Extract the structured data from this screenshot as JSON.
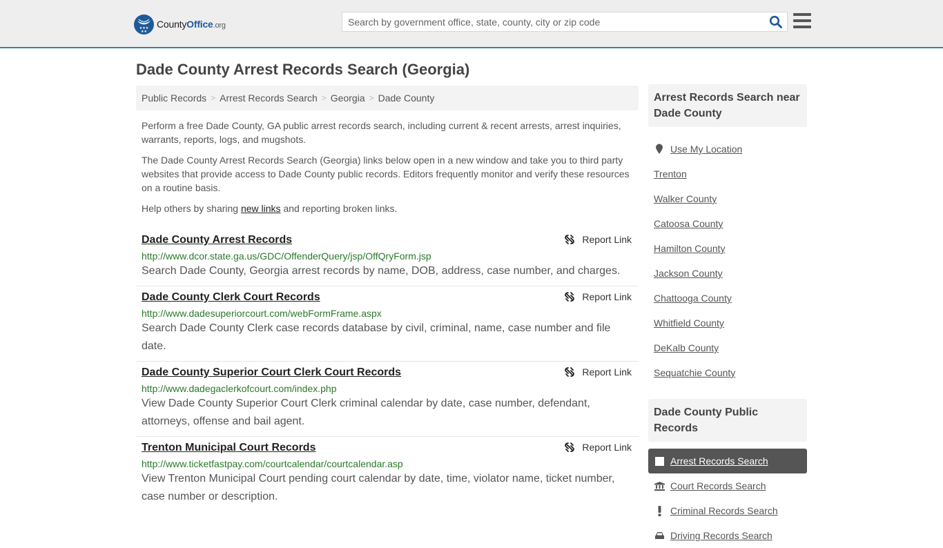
{
  "header": {
    "logo": {
      "name_part1": "County",
      "name_part2": "Office",
      "name_suffix": ".org"
    },
    "search": {
      "placeholder": "Search by government office, state, county, city or zip code",
      "value": ""
    },
    "colors": {
      "brand": "#1e5a99",
      "border_accent": "#3a7cac"
    }
  },
  "page": {
    "title": "Dade County Arrest Records Search (Georgia)"
  },
  "breadcrumb": [
    "Public Records",
    "Arrest Records Search",
    "Georgia",
    "Dade County"
  ],
  "intro": {
    "p1": "Perform a free Dade County, GA public arrest records search, including current & recent arrests, arrest inquiries, warrants, reports, logs, and mugshots.",
    "p2": "The Dade County Arrest Records Search (Georgia) links below open in a new window and take you to third party websites that provide access to Dade County public records. Editors frequently monitor and verify these resources on a routine basis.",
    "p3_before": "Help others by sharing ",
    "p3_link": "new links",
    "p3_after": " and reporting broken links."
  },
  "report_label": "Report Link",
  "records": [
    {
      "title": "Dade County Arrest Records",
      "url": "http://www.dcor.state.ga.us/GDC/OffenderQuery/jsp/OffQryForm.jsp",
      "desc": "Search Dade County, Georgia arrest records by name, DOB, address, case number, and charges."
    },
    {
      "title": "Dade County Clerk Court Records",
      "url": "http://www.dadesuperiorcourt.com/webFormFrame.aspx",
      "desc": "Search Dade County Clerk case records database by civil, criminal, name, case number and file date."
    },
    {
      "title": "Dade County Superior Court Clerk Court Records",
      "url": "http://www.dadegaclerkofcourt.com/index.php",
      "desc": "View Dade County Superior Court Clerk criminal calendar by date, case number, defendant, attorneys, offense and bail agent."
    },
    {
      "title": "Trenton Municipal Court Records",
      "url": "http://www.ticketfastpay.com/courtcalendar/courtcalendar.asp",
      "desc": "View Trenton Municipal Court pending court calendar by date, time, violator name, ticket number, case number or description."
    }
  ],
  "sidebar": {
    "nearby_heading": "Arrest Records Search near Dade County",
    "use_location": "Use My Location",
    "nearby": [
      "Trenton",
      "Walker County",
      "Catoosa County",
      "Hamilton County",
      "Jackson County",
      "Chattooga County",
      "Whitfield County",
      "DeKalb County",
      "Sequatchie County"
    ],
    "public_heading": "Dade County Public Records",
    "public_items": [
      {
        "label": "Arrest Records Search",
        "icon": "square-icon",
        "active": true
      },
      {
        "label": "Court Records Search",
        "icon": "courthouse-icon",
        "active": false
      },
      {
        "label": "Criminal Records Search",
        "icon": "exclamation-icon",
        "active": false
      },
      {
        "label": "Driving Records Search",
        "icon": "car-icon",
        "active": false
      }
    ]
  }
}
